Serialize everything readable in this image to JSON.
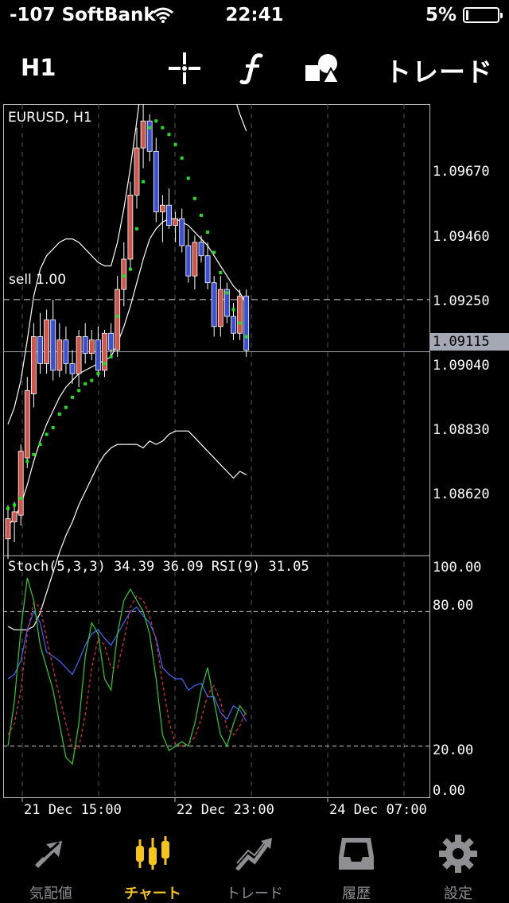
{
  "status_bar": {
    "carrier": "-107 SoftBank",
    "time": "22:41",
    "battery": "5%",
    "battery_level": 0.05
  },
  "toolbar": {
    "period": "H1",
    "crosshair_icon": "crosshair-icon",
    "function_icon": "function-icon",
    "objects_icon": "objects-icon",
    "trade_label": "トレード"
  },
  "chart": {
    "symbol": "EURUSD, H1",
    "order_label": "sell 1.00",
    "indicator_label": "Stoch(5,3,3) 34.39 36.09 RSI(9) 31.05",
    "current_price": "1.09115",
    "price_ticks": [
      "1.09670",
      "1.09460",
      "1.09250",
      "1.09040",
      "1.08830",
      "1.08620"
    ],
    "oscillator_ticks": [
      "100.00",
      "80.00",
      "20.00",
      "0.00"
    ],
    "time_ticks": [
      "21 Dec 15:00",
      "22 Dec 23:00",
      "24 Dec 07:00"
    ],
    "colors": {
      "bull": "#d0564b",
      "bear": "#3b4fd6",
      "sar": "#22dd22",
      "bands": "#ffffff",
      "stoch_main": "#33cc33",
      "stoch_signal": "#dd3333",
      "rsi": "#4466ff"
    }
  },
  "chart_data": {
    "type": "candlestick",
    "symbol": "EURUSD",
    "timeframe": "H1",
    "y_range": [
      1.0851,
      1.0985
    ],
    "oscillator_range": [
      0,
      100
    ],
    "current_price": 1.09115,
    "sell_level": 1.0927,
    "candles": [
      {
        "o": 1.0856,
        "h": 1.0866,
        "l": 1.085,
        "c": 1.0862
      },
      {
        "o": 1.0861,
        "h": 1.0867,
        "l": 1.0855,
        "c": 1.0864
      },
      {
        "o": 1.0863,
        "h": 1.0884,
        "l": 1.086,
        "c": 1.0882
      },
      {
        "o": 1.088,
        "h": 1.0904,
        "l": 1.0877,
        "c": 1.09
      },
      {
        "o": 1.0899,
        "h": 1.092,
        "l": 1.0895,
        "c": 1.0916
      },
      {
        "o": 1.0916,
        "h": 1.0923,
        "l": 1.0905,
        "c": 1.0908
      },
      {
        "o": 1.0908,
        "h": 1.0924,
        "l": 1.0905,
        "c": 1.0921
      },
      {
        "o": 1.0921,
        "h": 1.0927,
        "l": 1.0903,
        "c": 1.0906
      },
      {
        "o": 1.0906,
        "h": 1.092,
        "l": 1.0904,
        "c": 1.0915
      },
      {
        "o": 1.0915,
        "h": 1.0919,
        "l": 1.0905,
        "c": 1.0908
      },
      {
        "o": 1.0908,
        "h": 1.0912,
        "l": 1.0902,
        "c": 1.0905
      },
      {
        "o": 1.0905,
        "h": 1.0918,
        "l": 1.0901,
        "c": 1.0916
      },
      {
        "o": 1.0916,
        "h": 1.092,
        "l": 1.0908,
        "c": 1.0911
      },
      {
        "o": 1.0911,
        "h": 1.0918,
        "l": 1.0909,
        "c": 1.0915
      },
      {
        "o": 1.0915,
        "h": 1.0919,
        "l": 1.0904,
        "c": 1.0906
      },
      {
        "o": 1.0906,
        "h": 1.0918,
        "l": 1.0904,
        "c": 1.0917
      },
      {
        "o": 1.0917,
        "h": 1.092,
        "l": 1.091,
        "c": 1.0912
      },
      {
        "o": 1.0912,
        "h": 1.0934,
        "l": 1.091,
        "c": 1.093
      },
      {
        "o": 1.093,
        "h": 1.0944,
        "l": 1.0925,
        "c": 1.0939
      },
      {
        "o": 1.0939,
        "h": 1.0962,
        "l": 1.0936,
        "c": 1.0958
      },
      {
        "o": 1.0958,
        "h": 1.0978,
        "l": 1.0954,
        "c": 1.0972
      },
      {
        "o": 1.0972,
        "h": 1.0985,
        "l": 1.0966,
        "c": 1.098
      },
      {
        "o": 1.098,
        "h": 1.0982,
        "l": 1.0968,
        "c": 1.0971
      },
      {
        "o": 1.0971,
        "h": 1.0975,
        "l": 1.095,
        "c": 1.0953
      },
      {
        "o": 1.0953,
        "h": 1.0958,
        "l": 1.0944,
        "c": 1.0955
      },
      {
        "o": 1.0955,
        "h": 1.096,
        "l": 1.0948,
        "c": 1.0949
      },
      {
        "o": 1.0949,
        "h": 1.0953,
        "l": 1.0944,
        "c": 1.0951
      },
      {
        "o": 1.0951,
        "h": 1.0954,
        "l": 1.0941,
        "c": 1.0943
      },
      {
        "o": 1.0943,
        "h": 1.0948,
        "l": 1.0932,
        "c": 1.0934
      },
      {
        "o": 1.0934,
        "h": 1.0946,
        "l": 1.093,
        "c": 1.0944
      },
      {
        "o": 1.0944,
        "h": 1.0946,
        "l": 1.0938,
        "c": 1.094
      },
      {
        "o": 1.094,
        "h": 1.0944,
        "l": 1.093,
        "c": 1.0932
      },
      {
        "o": 1.0932,
        "h": 1.0934,
        "l": 1.0916,
        "c": 1.0919
      },
      {
        "o": 1.0919,
        "h": 1.0934,
        "l": 1.0916,
        "c": 1.093
      },
      {
        "o": 1.093,
        "h": 1.0932,
        "l": 1.092,
        "c": 1.0922
      },
      {
        "o": 1.0922,
        "h": 1.0926,
        "l": 1.0915,
        "c": 1.0917
      },
      {
        "o": 1.0917,
        "h": 1.093,
        "l": 1.0915,
        "c": 1.0928
      },
      {
        "o": 1.0928,
        "h": 1.093,
        "l": 1.091,
        "c": 1.0912
      }
    ],
    "sar": [
      1.0865,
      1.0866,
      1.0868,
      1.0879,
      1.0881,
      1.0884,
      1.0887,
      1.0889,
      1.0893,
      1.0895,
      1.0898,
      1.09,
      1.0902,
      1.0903,
      1.0905,
      1.0908,
      1.091,
      1.0922,
      1.0934,
      1.0936,
      1.0948,
      1.0962,
      1.0978,
      1.098,
      1.0978,
      1.0976,
      1.0973,
      1.0969,
      1.0963,
      1.0957,
      1.0952,
      1.0947,
      1.0941,
      1.0935,
      1.0929,
      1.0924,
      1.092,
      1.0916
    ],
    "bollinger_upper": [
      1.089,
      1.0895,
      1.0903,
      1.0915,
      1.0928,
      1.0936,
      1.094,
      1.0942,
      1.0944,
      1.0945,
      1.0945,
      1.0944,
      1.0942,
      1.094,
      1.0938,
      1.0937,
      1.0937,
      1.0944,
      1.0954,
      1.0966,
      1.098,
      1.0995,
      1.1005,
      1.1012,
      1.1015,
      1.1015,
      1.1014,
      1.1012,
      1.101,
      1.1008,
      1.1006,
      1.1004,
      1.1,
      1.0996,
      1.0992,
      1.0988,
      1.0982,
      1.0977
    ],
    "bollinger_middle": [
      1.086,
      1.0862,
      1.0866,
      1.0872,
      1.0879,
      1.0885,
      1.089,
      1.0894,
      1.0898,
      1.0901,
      1.0903,
      1.0905,
      1.0906,
      1.0907,
      1.0908,
      1.0909,
      1.091,
      1.0914,
      1.0919,
      1.0925,
      1.0932,
      1.0939,
      1.0945,
      1.0948,
      1.095,
      1.0951,
      1.0951,
      1.095,
      1.0949,
      1.0947,
      1.0945,
      1.0943,
      1.094,
      1.0937,
      1.0934,
      1.0931,
      1.0929,
      1.0926
    ],
    "bollinger_lower": [
      1.083,
      1.0829,
      1.0829,
      1.0829,
      1.083,
      1.0834,
      1.084,
      1.0846,
      1.0852,
      1.0857,
      1.0861,
      1.0866,
      1.087,
      1.0874,
      1.0878,
      1.0881,
      1.0883,
      1.0884,
      1.0884,
      1.0884,
      1.0884,
      1.0883,
      1.0885,
      1.0884,
      1.0885,
      1.0887,
      1.0888,
      1.0888,
      1.0888,
      1.0886,
      1.0884,
      1.0882,
      1.088,
      1.0878,
      1.0876,
      1.0874,
      1.0876,
      1.0875
    ],
    "stoch_main": [
      20,
      40,
      72,
      95,
      85,
      65,
      55,
      45,
      30,
      15,
      12,
      30,
      60,
      75,
      70,
      50,
      45,
      70,
      85,
      90,
      85,
      80,
      70,
      50,
      25,
      18,
      20,
      22,
      20,
      30,
      45,
      55,
      40,
      25,
      20,
      30,
      38,
      34
    ],
    "stoch_signal": [
      25,
      30,
      45,
      70,
      84,
      82,
      68,
      55,
      42,
      30,
      19,
      19,
      34,
      55,
      68,
      65,
      55,
      55,
      67,
      82,
      87,
      85,
      78,
      67,
      48,
      31,
      21,
      20,
      21,
      24,
      32,
      43,
      47,
      40,
      28,
      25,
      29,
      36
    ],
    "rsi": [
      50,
      52,
      58,
      72,
      80,
      75,
      62,
      60,
      58,
      55,
      52,
      58,
      65,
      70,
      72,
      68,
      65,
      70,
      75,
      80,
      82,
      78,
      75,
      68,
      55,
      52,
      50,
      50,
      45,
      47,
      48,
      42,
      42,
      35,
      32,
      38,
      36,
      31
    ],
    "x_labels": [
      "21 Dec 15:00",
      "22 Dec 23:00",
      "24 Dec 07:00"
    ]
  },
  "tab_bar": {
    "tabs": [
      {
        "label": "気配値",
        "icon": "quotes-icon"
      },
      {
        "label": "チャート",
        "icon": "chart-icon"
      },
      {
        "label": "トレード",
        "icon": "trade-icon"
      },
      {
        "label": "履歴",
        "icon": "history-icon"
      },
      {
        "label": "設定",
        "icon": "settings-icon"
      }
    ],
    "active_index": 1,
    "active_color": "#f5c518",
    "inactive_color": "#8e8e93"
  }
}
